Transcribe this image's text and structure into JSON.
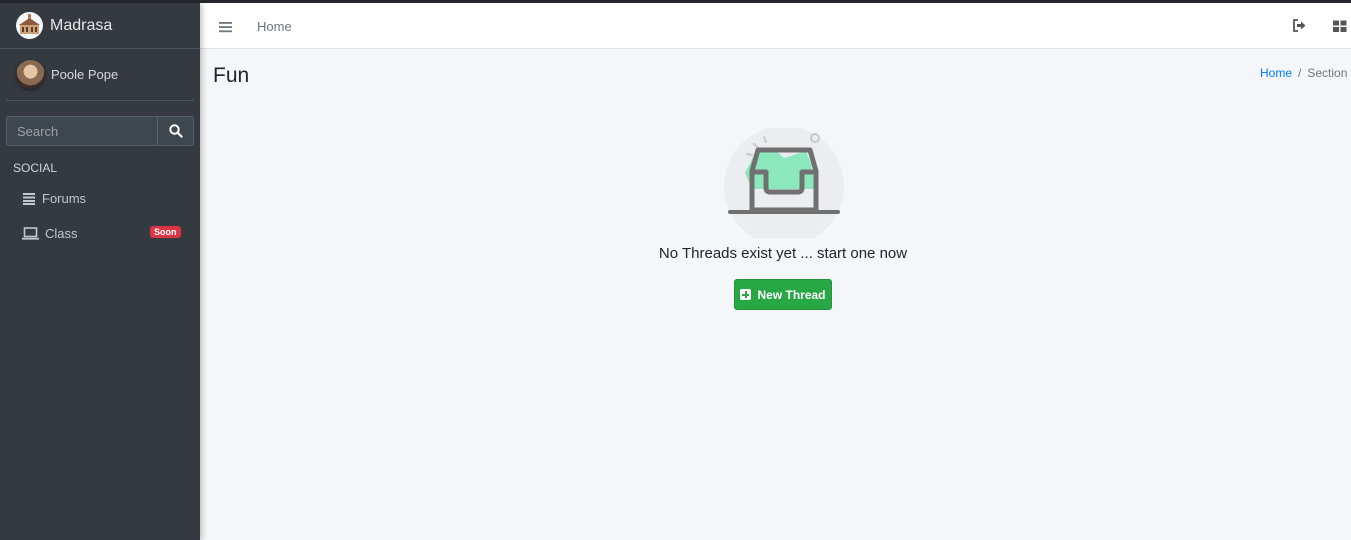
{
  "app": {
    "brand": "Madrasa"
  },
  "user": {
    "name": "Poole Pope"
  },
  "search": {
    "placeholder": "Search"
  },
  "sidebar": {
    "header": "SOCIAL",
    "items": [
      {
        "label": "Forums",
        "icon": "list-icon"
      },
      {
        "label": "Class",
        "icon": "laptop-icon",
        "badge": "Soon"
      }
    ]
  },
  "topnav": {
    "home_label": "Home"
  },
  "page": {
    "title": "Fun"
  },
  "breadcrumb": {
    "home": "Home",
    "separator": "/",
    "current": "Section"
  },
  "empty_state": {
    "message": "No Threads exist yet ... start one now",
    "button_label": "New Thread"
  },
  "colors": {
    "sidebar": "#343a40",
    "primary": "#007bff",
    "success": "#28a745",
    "danger": "#dc3545"
  }
}
